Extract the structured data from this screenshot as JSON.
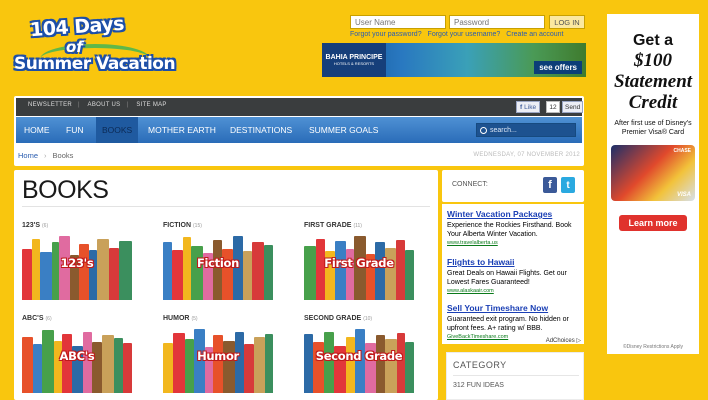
{
  "logo": {
    "line1": "104 Days",
    "line2": "of",
    "line3": "Summer Vacation"
  },
  "login": {
    "username_placeholder": "User Name",
    "password_placeholder": "Password",
    "login_label": "LOG IN",
    "forgot_password": "Forgot your password?",
    "forgot_username": "Forgot your username?",
    "create_account": "Create an account"
  },
  "bahia_ad": {
    "brand": "BAHIA PRINCIPE",
    "brand_sub": "HOTELS & RESORTS",
    "cta": "see offers"
  },
  "right_ad": {
    "line1": "Get a",
    "line2": "$100",
    "line3": "Statement",
    "line4": "Credit",
    "sub": "After first use of Disney's Premier Visa® Card",
    "card_brand": "CHASE",
    "card_network": "VISA",
    "cta": "Learn more",
    "fine": "©Disney Restrictions Apply"
  },
  "topbar": {
    "links": [
      "NEWSLETTER",
      "ABOUT US",
      "SITE MAP"
    ],
    "like_label": "Like",
    "like_count": "12",
    "send_label": "Send"
  },
  "nav": {
    "items": [
      "HOME",
      "FUN",
      "BOOKS",
      "MOTHER EARTH",
      "DESTINATIONS",
      "SUMMER GOALS"
    ],
    "active": "BOOKS",
    "search_placeholder": "search..."
  },
  "breadcrumb": {
    "home": "Home",
    "current": "Books"
  },
  "date": "WEDNESDAY, 07 NOVEMBER 2012",
  "page_title": "BOOKS",
  "categories": [
    {
      "title": "123'S",
      "count": "(6)",
      "label": "123's"
    },
    {
      "title": "FICTION",
      "count": "(15)",
      "label": "Fiction"
    },
    {
      "title": "FIRST GRADE",
      "count": "(11)",
      "label": "First Grade"
    },
    {
      "title": "ABC'S",
      "count": "(6)",
      "label": "ABC's"
    },
    {
      "title": "HUMOR",
      "count": "(5)",
      "label": "Humor"
    },
    {
      "title": "SECOND GRADE",
      "count": "(10)",
      "label": "Second Grade"
    }
  ],
  "connect_label": "CONNECT:",
  "text_ads": [
    {
      "headline": "Winter Vacation Packages",
      "desc": "Experience the Rockies Firsthand. Book Your Alberta Winter Vacation.",
      "url": "www.travelalberta.us"
    },
    {
      "headline": "Flights to Hawaii",
      "desc": "Great Deals on Hawaii Flights. Get our Lowest Fares Guaranteed!",
      "url": "www.alaskaair.com"
    },
    {
      "headline": "Sell Your Timeshare Now",
      "desc": "Guaranteed exit program. No hidden or upfront fees. A+ rating w/ BBB.",
      "url": "GiveBackTimeshare.com"
    }
  ],
  "ad_choices": "AdChoices",
  "category_box": {
    "heading": "CATEGORY",
    "first_item": "312 FUN IDEAS"
  },
  "colors": {
    "background": "#f9c60e",
    "nav_blue": "#2a6cb8",
    "link_blue": "#1a3fb5",
    "label_red": "#c01a1a"
  }
}
